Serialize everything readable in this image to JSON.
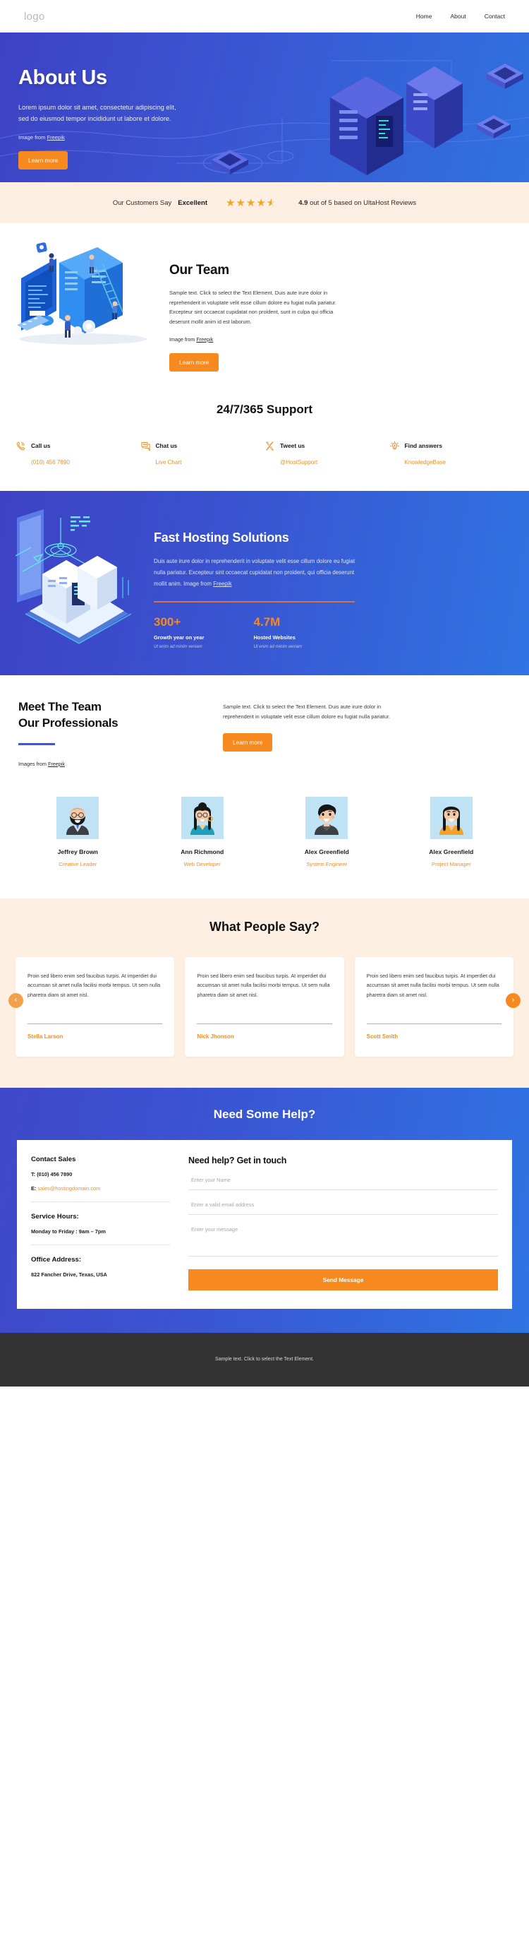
{
  "nav": {
    "logo": "logo",
    "links": [
      {
        "label": "Home"
      },
      {
        "label": "About"
      },
      {
        "label": "Contact"
      }
    ]
  },
  "hero": {
    "title": "About Us",
    "subtitle": "Lorem ipsum dolor sit amet, consectetur adipiscing elit, sed do eiusmod tempor incididunt ut labore et dolore.",
    "credit_prefix": "Image from ",
    "credit_link": "Freepik",
    "button": "Learn more",
    "bg_start": "#3d42c4",
    "bg_end": "#2f72e0"
  },
  "reviewbar": {
    "lead": "Our Customers Say",
    "rating_word": "Excellent",
    "stars_full": 4,
    "stars_half": 1,
    "score": "4.9",
    "score_rest": " out of 5 based on UltaHost Reviews",
    "star_color": "#f5a623",
    "bg": "#fdf0e3"
  },
  "team": {
    "title": "Our Team",
    "body": "Sample text. Click to select the Text Element. Duis aute irure dolor in reprehenderit in voluptate velit esse cillum dolore eu fugiat nulla pariatur. Excepteur sint occaecat cupidatat non proident, sunt in culpa qui officia deserunt mollit anim id est laborum.",
    "credit_prefix": "Image from ",
    "credit_link": "Freepik",
    "button": "Learn more"
  },
  "support": {
    "title": "24/7/365 Support",
    "items": [
      {
        "icon": "phone-icon",
        "title": "Call us",
        "link": "(010) 456 7890"
      },
      {
        "icon": "chat-icon",
        "title": "Chat us",
        "link": "Live Chart"
      },
      {
        "icon": "x-twitter-icon",
        "title": "Tweet us",
        "link": "@HostSupport"
      },
      {
        "icon": "lightbulb-icon",
        "title": "Find answers",
        "link": "KnowledgeBase"
      }
    ],
    "link_color": "#e9922e"
  },
  "fast": {
    "title": "Fast Hosting Solutions",
    "body": "Duis aute irure dolor in reprehenderit in voluptate velit esse cillum dolore eu fugiat nulla pariatur. Excepteur sint occaecat cupidatat non proident, qui officia deserunt mollit anim. ",
    "body_credit_prefix": "Image from ",
    "body_credit_link": "Freepik",
    "stats": [
      {
        "value": "300+",
        "label": "Growth year on year",
        "sub": "Ut enim ad minim veniam"
      },
      {
        "value": "4.7M",
        "label": "Hosted Websites",
        "sub": "Ut enim ad minim veniam"
      }
    ],
    "accent": "#f68a1e"
  },
  "meet": {
    "line1": "Meet The Team",
    "line2": "Our Professionals",
    "credit_prefix": "Images from ",
    "credit_link": "Freepik",
    "body": "Sample text. Click to select the Text Element. Duis aute irure dolor in reprehenderit in voluptate velit esse cillum dolore eu fugiat nulla pariatur.",
    "button": "Learn more",
    "bar_color": "#4a52c8"
  },
  "members": [
    {
      "name": "Jeffrey Brown",
      "role": "Creative Leader",
      "avatar": "avatar-bearded-man"
    },
    {
      "name": "Ann Richmond",
      "role": "Web Developer",
      "avatar": "avatar-woman-teal"
    },
    {
      "name": "Alex Greenfield",
      "role": "System Engineer",
      "avatar": "avatar-man-dark"
    },
    {
      "name": "Alex Greenfield",
      "role": "Project Manager",
      "avatar": "avatar-woman-orange"
    }
  ],
  "testimonials": {
    "title": "What People Say?",
    "prev_icon": "chevron-left-icon",
    "next_icon": "chevron-right-icon",
    "cards": [
      {
        "quote": "Proin sed libero enim sed faucibus turpis. At imperdiet dui accumsan sit amet nulla facilisi morbi tempus. Ut sem nulla pharetra diam sit amet nisl.",
        "name": "Stella Larson"
      },
      {
        "quote": "Proin sed libero enim sed faucibus turpis. At imperdiet dui accumsan sit amet nulla facilisi morbi tempus. Ut sem nulla pharetra diam sit amet nisl.",
        "name": "Nick Jhonson"
      },
      {
        "quote": "Proin sed libero enim sed faucibus turpis. At imperdiet dui accumsan sit amet nulla facilisi morbi tempus. Ut sem nulla pharetra diam sit amet nisl.",
        "name": "Scott Smith"
      }
    ]
  },
  "contact": {
    "title": "Need Some Help?",
    "sales_heading": "Contact Sales",
    "phone": "T: (010) 456 7890",
    "email_prefix": "E: ",
    "email": "sales@hostingdomain.com",
    "hours_heading": "Service Hours:",
    "hours": "Monday to Friday : 9am – 7pm",
    "address_heading": "Office Address:",
    "address": "822 Fancher Drive, Texas, USA",
    "form_title": "Need help? Get in touch",
    "name_placeholder": "Enter your Name",
    "email_placeholder": "Enter a valid email address",
    "message_placeholder": "Enter your message",
    "submit": "Send Message"
  },
  "footer": {
    "text": "Sample text. Click to select the Text Element."
  }
}
